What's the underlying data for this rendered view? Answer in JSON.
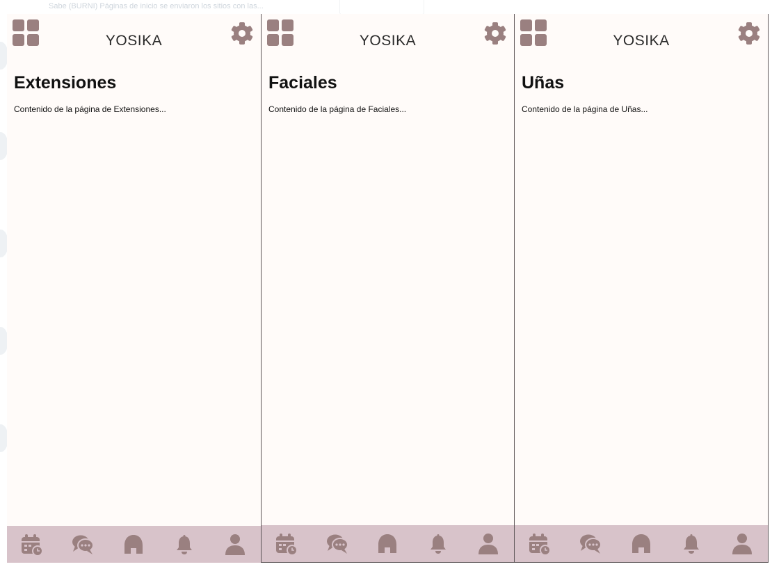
{
  "theme": {
    "accent": "#9a8080",
    "nav_bg": "#d8c3ca",
    "screen_bg": "#fffbf9",
    "border": "#5b5456"
  },
  "background": {
    "top_text": "Sabe (BURNI) Páginas de inicio se enviaron los sitios con las..."
  },
  "screens": [
    {
      "brand": "YOSIKA",
      "title": "Extensiones",
      "content": "Contenido de la página de Extensiones...",
      "icons": {
        "left": "grid-icon",
        "right": "gear-icon"
      },
      "nav": [
        "calendar-clock-icon",
        "chat-bubbles-icon",
        "home-icon",
        "bell-icon",
        "user-icon"
      ]
    },
    {
      "brand": "YOSIKA",
      "title": "Faciales",
      "content": "Contenido de la página de Faciales...",
      "icons": {
        "left": "grid-icon",
        "right": "gear-icon"
      },
      "nav": [
        "calendar-clock-icon",
        "chat-bubbles-icon",
        "home-icon",
        "bell-icon",
        "user-icon"
      ]
    },
    {
      "brand": "YOSIKA",
      "title": "Uñas",
      "content": "Contenido de la página de Uñas...",
      "icons": {
        "left": "grid-icon",
        "right": "gear-icon"
      },
      "nav": [
        "calendar-clock-icon",
        "chat-bubbles-icon",
        "home-icon",
        "bell-icon",
        "user-icon"
      ]
    }
  ]
}
